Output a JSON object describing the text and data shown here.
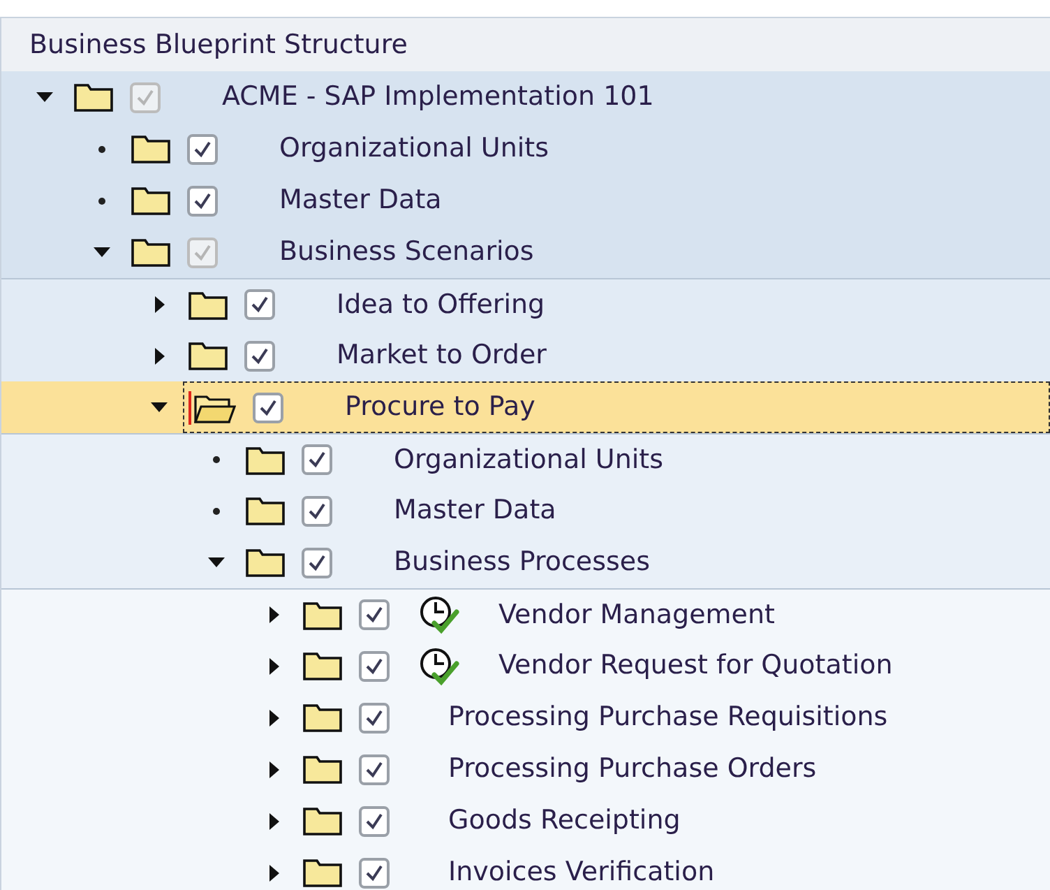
{
  "panel": {
    "title": "Business Blueprint Structure"
  },
  "tree": [
    {
      "label": "ACME - SAP Implementation 101",
      "expanded": true,
      "checked": true,
      "disabled": true,
      "selected": false,
      "children": [
        {
          "label": "Organizational Units",
          "kind": "leaf",
          "checked": true,
          "disabled": false,
          "selected": false
        },
        {
          "label": "Master Data",
          "kind": "leaf",
          "checked": true,
          "disabled": false,
          "selected": false
        },
        {
          "label": "Business Scenarios",
          "expanded": true,
          "checked": true,
          "disabled": true,
          "selected": false,
          "children": [
            {
              "label": "Idea to Offering",
              "expanded": false,
              "checked": true,
              "disabled": false,
              "selected": false
            },
            {
              "label": "Market to Order",
              "expanded": false,
              "checked": true,
              "disabled": false,
              "selected": false
            },
            {
              "label": "Procure to Pay",
              "expanded": true,
              "checked": true,
              "disabled": false,
              "selected": true,
              "children": [
                {
                  "label": "Organizational Units",
                  "kind": "leaf",
                  "checked": true,
                  "disabled": false,
                  "selected": false
                },
                {
                  "label": "Master Data",
                  "kind": "leaf",
                  "checked": true,
                  "disabled": false,
                  "selected": false
                },
                {
                  "label": "Business Processes",
                  "expanded": true,
                  "checked": true,
                  "disabled": false,
                  "selected": false,
                  "children": [
                    {
                      "label": "Vendor Management",
                      "expanded": false,
                      "checked": true,
                      "disabled": false,
                      "selected": false,
                      "status_icon": true
                    },
                    {
                      "label": "Vendor Request for Quotation",
                      "expanded": false,
                      "checked": true,
                      "disabled": false,
                      "selected": false,
                      "status_icon": true
                    },
                    {
                      "label": "Processing Purchase Requisitions",
                      "expanded": false,
                      "checked": true,
                      "disabled": false,
                      "selected": false,
                      "status_icon": false
                    },
                    {
                      "label": "Processing Purchase Orders",
                      "expanded": false,
                      "checked": true,
                      "disabled": false,
                      "selected": false,
                      "status_icon": false
                    },
                    {
                      "label": "Goods Receipting",
                      "expanded": false,
                      "checked": true,
                      "disabled": false,
                      "selected": false,
                      "status_icon": false
                    },
                    {
                      "label": "Invoices Verification",
                      "expanded": false,
                      "checked": true,
                      "disabled": false,
                      "selected": false,
                      "status_icon": false
                    }
                  ]
                }
              ]
            }
          ]
        }
      ]
    }
  ]
}
